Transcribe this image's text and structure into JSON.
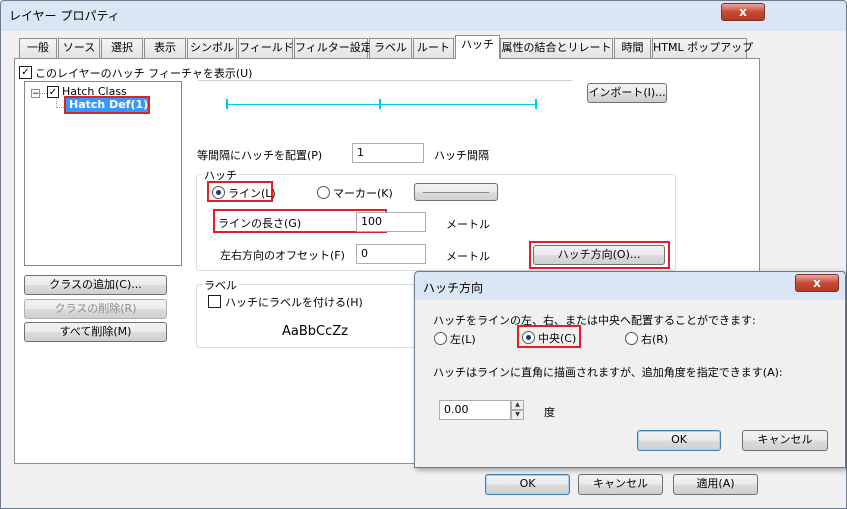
{
  "window": {
    "title": "レイヤー プロパティ",
    "close": "x"
  },
  "tabs": [
    "一般",
    "ソース",
    "選択",
    "表示",
    "シンボル",
    "フィールド",
    "フィルター設定",
    "ラベル",
    "ルート",
    "ハッチ",
    "属性の結合とリレート",
    "時間",
    "HTML ポップアップ"
  ],
  "active_tab": "ハッチ",
  "show_hatch_label": "このレイヤーのハッチ フィーチャを表示(U)",
  "tree": {
    "root": "Hatch Class",
    "child": "Hatch Def(1)"
  },
  "import_button": "インポート(I)...",
  "interval": {
    "label": "等間隔にハッチを配置(P)",
    "value": "1",
    "unit": "ハッチ間隔"
  },
  "hatch_group": {
    "title": "ハッチ",
    "line_radio": "ライン(L)",
    "marker_radio": "マーカー(K)",
    "length_label": "ラインの長さ(G)",
    "length_value": "100",
    "length_unit": "メートル",
    "offset_label": "左右方向のオフセット(F)",
    "offset_value": "0",
    "offset_unit": "メートル",
    "direction_button": "ハッチ方向(O)..."
  },
  "label_group": {
    "title": "ラベル",
    "checkbox": "ハッチにラベルを付ける(H)",
    "sample": "AaBbCcZz"
  },
  "left_buttons": {
    "add": "クラスの追加(C)...",
    "remove": "クラスの削除(R)",
    "remove_all": "すべて削除(M)"
  },
  "footer": {
    "ok": "OK",
    "cancel": "キャンセル",
    "apply": "適用(A)"
  },
  "dialog": {
    "title": "ハッチ方向",
    "close": "x",
    "text1": "ハッチをラインの左、右、または中央へ配置することができます:",
    "left": "左(L)",
    "center": "中央(C)",
    "right": "右(R)",
    "text2": "ハッチはラインに直角に描画されますが、追加角度を指定できます(A):",
    "angle_value": "0.00",
    "angle_unit": "度",
    "ok": "OK",
    "cancel": "キャンセル"
  },
  "colors": {
    "highlight_box": "#e01f26",
    "hatch_preview": "#00c8e8",
    "selected_node": "#3399ff"
  }
}
